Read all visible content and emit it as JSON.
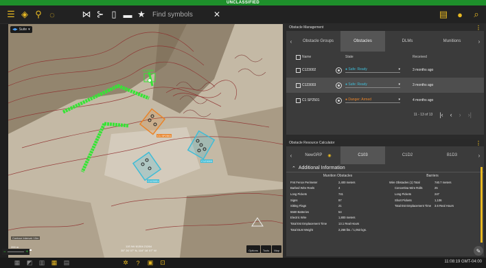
{
  "classification": "UNCLASSIFIED",
  "toolbar": {
    "search_placeholder": "Find symbols",
    "icons": [
      "menu-icon",
      "layers-icon",
      "map-pin-icon",
      "lasso-icon",
      "route-icon",
      "branch-icon",
      "clipboard-icon",
      "folder-icon",
      "star-icon",
      "close-icon",
      "report-icon",
      "notifications-icon",
      "search-icon"
    ],
    "notification_count": "0"
  },
  "map": {
    "app_chip": "Suite",
    "contour_interval": "Contour Interval: 10m",
    "scale_top": "200 m",
    "scale_bottom": "1000 ft",
    "coords_line1": "11S NV 61304 21264",
    "coords_line2": "35° 26' 07\" N, 116° 16' 07\" W",
    "btn_options": "Options",
    "btn_tools": "Tools",
    "btn_map": "Map",
    "labels": [
      "C123002",
      "C1 SP2501",
      "C123003",
      "C123001"
    ]
  },
  "obstacle_management": {
    "title": "Obstacle Management",
    "tabs": [
      "Obstacle Groups",
      "Obstacles",
      "DLMs",
      "Munitions"
    ],
    "columns": [
      "Name",
      "State",
      "Received"
    ],
    "rows": [
      {
        "name": "C123002",
        "state": "● Safe: Ready",
        "received": "3 months ago"
      },
      {
        "name": "C123003",
        "state": "● Safe: Ready",
        "received": "3 months ago"
      },
      {
        "name": "C1 SP2501",
        "state": "● Danger: Armed",
        "received": "4 months ago"
      }
    ],
    "pager": "11 - 13 of 13"
  },
  "resource_calculator": {
    "title": "Obstacle Resource Calculator",
    "tabs": [
      "NewGRP",
      "C103",
      "C1D2",
      "B1D3"
    ],
    "section": "Additional Information",
    "munitions_title": "Munition Obstacles",
    "barriers_title": "Barriers",
    "munitions": [
      {
        "k": "Fmt Fence Perimeter",
        "v": "2,400 meters"
      },
      {
        "k": "Barbed Wire Reels",
        "v": "4"
      },
      {
        "k": "Long Pickets",
        "v": "741"
      },
      {
        "k": "Signs",
        "v": "97"
      },
      {
        "k": "Sitting Flags",
        "v": "21"
      },
      {
        "k": "5560 Batteries",
        "v": "54"
      },
      {
        "k": "Electric Wire",
        "v": "1,800 meters"
      },
      {
        "k": "Total Est Emplacement Time",
        "v": "13.1 Real Hours"
      },
      {
        "k": "Total DLM Weight",
        "v": "2,268 lbs. / 1,053 kgs."
      }
    ],
    "barriers": [
      {
        "k": "Wire Obstacles (1) Total",
        "v": "740.7 meters"
      },
      {
        "k": "Concertina Wire Rolls",
        "v": "25"
      },
      {
        "k": "Long Pickets",
        "v": "247"
      },
      {
        "k": "Short Pickets",
        "v": "1,106"
      },
      {
        "k": "Total Est Emplacement Time",
        "v": "3.6 Real Hours"
      }
    ]
  },
  "status": {
    "clock": "11:08:19 GMT-04:00"
  },
  "colors": {
    "accent": "#e8b923",
    "classification": "#1e8f2b",
    "danger": "#e8842a",
    "safe": "#3fbcd6"
  }
}
